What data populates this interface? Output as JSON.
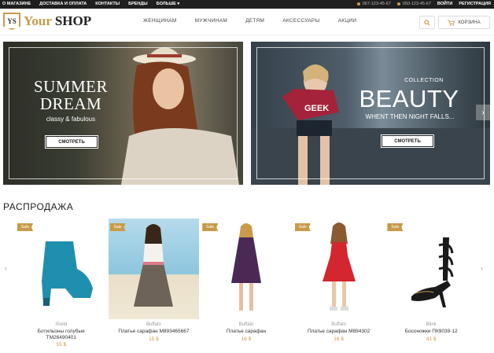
{
  "topbar": {
    "links": [
      "О МАГАЗИНЕ",
      "ДОСТАВКА И ОПЛАТА",
      "КОНТАКТЫ",
      "БРЕНДЫ",
      "БОЛЬШЕ"
    ],
    "phone1": "067-123-45-67",
    "phone2": "050-123-45-67",
    "login": "ВОЙТИ",
    "register": "РЕГИСТРАЦИЯ"
  },
  "header": {
    "logo_badge": "YS",
    "logo_word1": "Your",
    "logo_word2": "SHOP",
    "nav": [
      "ЖЕНЩИНАМ",
      "МУЖЧИНАМ",
      "ДЕТЯМ",
      "АКСЕССУАРЫ",
      "АКЦИИ"
    ],
    "cart_label": "КОРЗИНА"
  },
  "banner1": {
    "title_line1": "SUMMER",
    "title_line2": "DREAM",
    "subtitle": "classy & fabulous",
    "button": "СМОТРЕТЬ"
  },
  "banner2": {
    "kicker": "COLLECTION",
    "title": "BEAUTY",
    "subtitle": "WHENT THEN NIGHT FALLS...",
    "shirt_text": "GEEK",
    "button": "СМОТРЕТЬ"
  },
  "sale_section": {
    "title": "РАСПРОДАЖА",
    "badge": "Sale",
    "products": [
      {
        "brand": "iSolid",
        "name_line1": "Ботильоны голубые",
        "name_line2": "TM26490401",
        "price": "55 $",
        "color": "#1f8fb0"
      },
      {
        "brand": "Buffalo",
        "name_line1": "Платье сарафан M893465667",
        "name_line2": "",
        "price": "15 $",
        "color": "#e6d9c4"
      },
      {
        "brand": "Buffalo",
        "name_line1": "Платье сарафан",
        "name_line2": "",
        "price": "16 $",
        "color": "#4a2a55"
      },
      {
        "brand": "Buffalo",
        "name_line1": "Платье сарафан M894302",
        "name_line2": "",
        "price": "16 $",
        "color": "#d3262e"
      },
      {
        "brand": "Blink",
        "name_line1": "Босоножки ПК9039-12",
        "name_line2": "",
        "price": "41 $",
        "color": "#1a1a1a"
      }
    ]
  },
  "colors": {
    "accent": "#c89a4a",
    "topbar": "#1f1f1f"
  }
}
